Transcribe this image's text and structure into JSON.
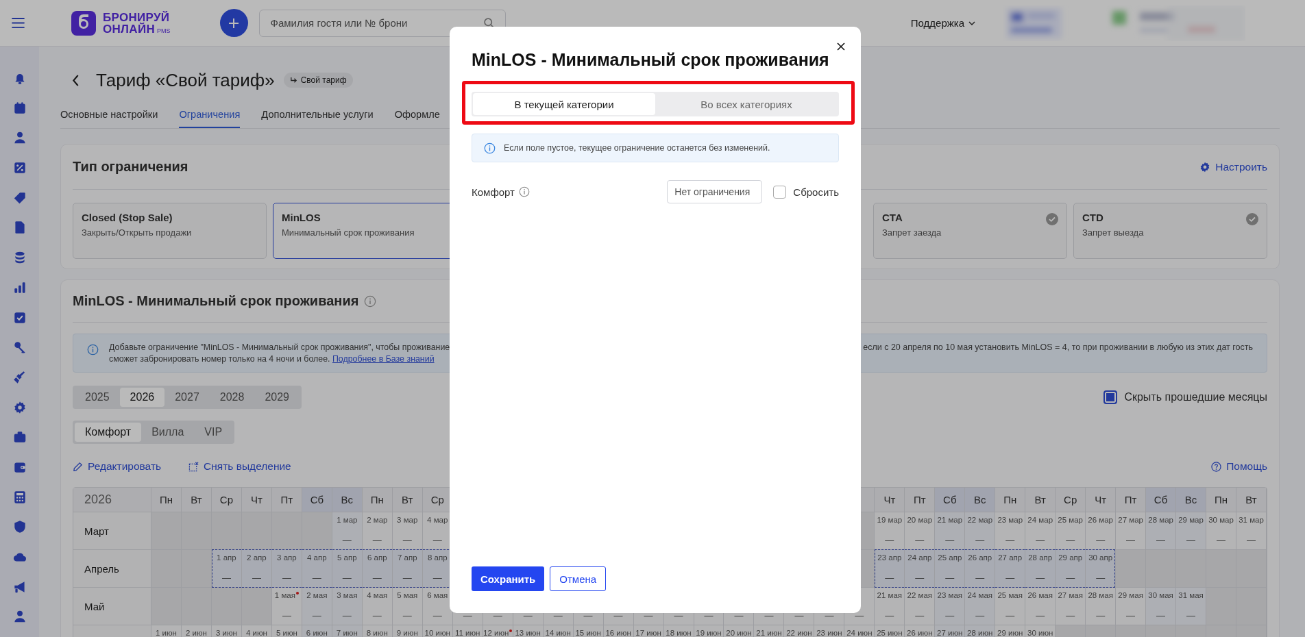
{
  "header": {
    "logo": {
      "line1": "БРОНИРУЙ",
      "line2": "ОНЛАЙН",
      "suffix": "PMS"
    },
    "search": {
      "placeholder": "Фамилия гостя или № брони"
    },
    "support": "Поддержка"
  },
  "page": {
    "title": "Тариф «Свой тариф»",
    "badge": "Свой тариф",
    "tabs": [
      {
        "label": "Основные настройки",
        "selected": false
      },
      {
        "label": "Ограничения",
        "selected": true
      },
      {
        "label": "Дополнительные услуги",
        "selected": false
      },
      {
        "label": "Оформле",
        "selected": false
      }
    ]
  },
  "restriction_type": {
    "title": "Тип ограничения",
    "configure": "Настроить",
    "options": [
      {
        "title": "Closed (Stop Sale)",
        "subtitle": "Закрыть/Открыть продажи",
        "selected": false,
        "checked": false
      },
      {
        "title": "MinLOS",
        "subtitle": "Минимальный срок проживания",
        "selected": true,
        "checked": false
      },
      {
        "title": "CTA",
        "subtitle": "Запрет заезда",
        "selected": false,
        "checked": true
      },
      {
        "title": "CTD",
        "subtitle": "Запрет выезда",
        "selected": false,
        "checked": true
      }
    ]
  },
  "minlos": {
    "title": "MinLOS - Минимальный срок проживания",
    "info": {
      "line1": "Добавьте ограничение \"MinLOS - Минимальный срок проживания\", чтобы проживание",
      "line2": "сможет забронировать номер только на 4 ночи и более.",
      "link": "Подробнее в Базе знаний",
      "right": "если с 20 апреля по 10 мая установить MinLOS = 4, то при проживании в любую из этих дат гость"
    },
    "years": [
      {
        "label": "2025",
        "selected": false
      },
      {
        "label": "2026",
        "selected": true
      },
      {
        "label": "2027",
        "selected": false
      },
      {
        "label": "2028",
        "selected": false
      },
      {
        "label": "2029",
        "selected": false
      }
    ],
    "hide_past": {
      "label": "Скрыть прошедшие месяцы",
      "checked": true
    },
    "categories": [
      {
        "label": "Комфорт",
        "selected": true
      },
      {
        "label": "Вилла",
        "selected": false
      },
      {
        "label": "VIP",
        "selected": false
      }
    ],
    "actions": {
      "edit": "Редактировать",
      "deselect": "Снять выделение",
      "help": "Помощь"
    },
    "calendar": {
      "year": "2026",
      "columns": [
        {
          "label": "Пн",
          "weekend": false
        },
        {
          "label": "Вт",
          "weekend": false
        },
        {
          "label": "Ср",
          "weekend": false
        },
        {
          "label": "Чт",
          "weekend": false
        },
        {
          "label": "Пт",
          "weekend": false
        },
        {
          "label": "Сб",
          "weekend": true
        },
        {
          "label": "Вс",
          "weekend": true
        },
        {
          "label": "Пн",
          "weekend": false
        },
        {
          "label": "Вт",
          "weekend": false
        },
        {
          "label": "Ср",
          "weekend": false
        },
        null,
        null,
        null,
        null,
        null,
        null,
        null,
        null,
        null,
        null,
        null,
        null,
        null,
        null,
        {
          "label": "Чт",
          "weekend": false
        },
        {
          "label": "Пт",
          "weekend": false
        },
        {
          "label": "Сб",
          "weekend": true
        },
        {
          "label": "Вс",
          "weekend": true
        },
        {
          "label": "Пн",
          "weekend": false
        },
        {
          "label": "Вт",
          "weekend": false
        },
        {
          "label": "Ср",
          "weekend": false
        },
        {
          "label": "Чт",
          "weekend": false
        },
        {
          "label": "Пт",
          "weekend": false
        },
        {
          "label": "Сб",
          "weekend": true
        },
        {
          "label": "Вс",
          "weekend": true
        },
        {
          "label": "Пн",
          "weekend": false
        },
        {
          "label": "Вт",
          "weekend": false
        }
      ],
      "rows": [
        {
          "name": "Март",
          "selected": false,
          "cells": [
            null,
            null,
            null,
            null,
            null,
            null,
            {
              "date": "1 мар",
              "value": "—",
              "holiday": false
            },
            {
              "date": "2 мар",
              "value": "—",
              "holiday": false
            },
            {
              "date": "3 мар",
              "value": "—",
              "holiday": false
            },
            {
              "date": "4 мар",
              "value": "—",
              "holiday": false
            },
            null,
            null,
            null,
            null,
            null,
            null,
            null,
            null,
            null,
            null,
            null,
            null,
            null,
            null,
            {
              "date": "19 мар",
              "value": "—",
              "holiday": false
            },
            {
              "date": "20 мар",
              "value": "—",
              "holiday": false
            },
            {
              "date": "21 мар",
              "value": "—",
              "holiday": false
            },
            {
              "date": "22 мар",
              "value": "—",
              "holiday": false
            },
            {
              "date": "23 мар",
              "value": "—",
              "holiday": false
            },
            {
              "date": "24 мар",
              "value": "—",
              "holiday": false
            },
            {
              "date": "25 мар",
              "value": "—",
              "holiday": false
            },
            {
              "date": "26 мар",
              "value": "—",
              "holiday": false
            },
            {
              "date": "27 мар",
              "value": "—",
              "holiday": false
            },
            {
              "date": "28 мар",
              "value": "—",
              "holiday": false
            },
            {
              "date": "29 мар",
              "value": "—",
              "holiday": false
            },
            {
              "date": "30 мар",
              "value": "—",
              "holiday": false
            },
            {
              "date": "31 мар",
              "value": "—",
              "holiday": false
            }
          ]
        },
        {
          "name": "Апрель",
          "selected": true,
          "cells": [
            null,
            null,
            {
              "date": "1 апр",
              "value": "—",
              "holiday": false
            },
            {
              "date": "2 апр",
              "value": "—",
              "holiday": false
            },
            {
              "date": "3 апр",
              "value": "—",
              "holiday": false
            },
            {
              "date": "4 апр",
              "value": "—",
              "holiday": false
            },
            {
              "date": "5 апр",
              "value": "—",
              "holiday": false
            },
            {
              "date": "6 апр",
              "value": "—",
              "holiday": false
            },
            {
              "date": "7 апр",
              "value": "—",
              "holiday": false
            },
            {
              "date": "8 апр",
              "value": "—",
              "holiday": false
            },
            null,
            null,
            null,
            null,
            null,
            null,
            null,
            null,
            null,
            null,
            null,
            null,
            null,
            null,
            {
              "date": "23 апр",
              "value": "—",
              "holiday": false
            },
            {
              "date": "24 апр",
              "value": "—",
              "holiday": false
            },
            {
              "date": "25 апр",
              "value": "—",
              "holiday": false
            },
            {
              "date": "26 апр",
              "value": "—",
              "holiday": false
            },
            {
              "date": "27 апр",
              "value": "—",
              "holiday": false
            },
            {
              "date": "28 апр",
              "value": "—",
              "holiday": false
            },
            {
              "date": "29 апр",
              "value": "—",
              "holiday": false
            },
            {
              "date": "30 апр",
              "value": "—",
              "holiday": false
            },
            null,
            null,
            null,
            null,
            null
          ]
        },
        {
          "name": "Май",
          "selected": false,
          "cells": [
            null,
            null,
            null,
            null,
            {
              "date": "1 мая",
              "value": "—",
              "holiday": true
            },
            {
              "date": "2 мая",
              "value": "—",
              "holiday": false
            },
            {
              "date": "3 мая",
              "value": "—",
              "holiday": false
            },
            {
              "date": "4 мая",
              "value": "—",
              "holiday": false
            },
            {
              "date": "5 мая",
              "value": "—",
              "holiday": false
            },
            {
              "date": "6 мая",
              "value": "—",
              "holiday": false
            },
            {
              "value": "—"
            },
            {
              "value": "—"
            },
            {
              "value": "—"
            },
            {
              "value": "—"
            },
            {
              "value": "—"
            },
            {
              "value": "—"
            },
            {
              "value": "—"
            },
            {
              "value": "—"
            },
            {
              "value": "—"
            },
            {
              "value": "—"
            },
            {
              "value": "—"
            },
            {
              "value": "—"
            },
            {
              "value": "—"
            },
            {
              "value": "—"
            },
            {
              "date": "21 мая",
              "value": "—",
              "holiday": false
            },
            {
              "date": "22 мая",
              "value": "—",
              "holiday": false
            },
            {
              "date": "23 мая",
              "value": "—",
              "holiday": false
            },
            {
              "date": "24 мая",
              "value": "—",
              "holiday": false
            },
            {
              "date": "25 мая",
              "value": "—",
              "holiday": false
            },
            {
              "date": "26 мая",
              "value": "—",
              "holiday": false
            },
            {
              "date": "27 мая",
              "value": "—",
              "holiday": false
            },
            {
              "date": "28 мая",
              "value": "—",
              "holiday": false
            },
            {
              "date": "29 мая",
              "value": "—",
              "holiday": false
            },
            {
              "date": "30 мая",
              "value": "—",
              "holiday": false
            },
            {
              "date": "31 мая",
              "value": "—",
              "holiday": false
            },
            null,
            null
          ]
        },
        {
          "selected": false,
          "cells": [
            {
              "date": "1 июн",
              "holiday": false
            },
            {
              "date": "2 июн",
              "holiday": false
            },
            {
              "date": "3 июн",
              "holiday": false
            },
            {
              "date": "4 июн",
              "holiday": false
            },
            {
              "date": "5 июн",
              "holiday": false
            },
            {
              "date": "6 июн",
              "holiday": false
            },
            {
              "date": "7 июн",
              "holiday": false
            },
            {
              "date": "8 июн",
              "holiday": false
            },
            {
              "date": "9 июн",
              "holiday": false
            },
            {
              "date": "10 июн",
              "holiday": false
            },
            {
              "date": "11 июн",
              "holiday": false
            },
            {
              "date": "12 июн",
              "holiday": true
            },
            {
              "date": "13 июн",
              "holiday": false
            },
            {
              "date": "14 июн",
              "holiday": false
            },
            {
              "date": "15 июн",
              "holiday": false
            },
            {
              "date": "16 июн",
              "holiday": false
            },
            {
              "date": "17 июн",
              "holiday": false
            },
            {
              "date": "18 июн",
              "holiday": false
            },
            {
              "date": "19 июн",
              "holiday": false
            },
            {
              "date": "20 июн",
              "holiday": false
            },
            {
              "date": "21 июн",
              "holiday": false
            },
            {
              "date": "22 июн",
              "holiday": false
            },
            {
              "date": "23 июн",
              "holiday": false
            },
            {
              "date": "24 июн",
              "holiday": false
            },
            {
              "date": "25 июн",
              "holiday": false
            },
            {
              "date": "26 июн",
              "holiday": false
            },
            {
              "date": "27 июн",
              "holiday": false
            },
            {
              "date": "28 июн",
              "holiday": false
            },
            {
              "date": "29 июн",
              "holiday": false
            },
            {
              "date": "30 июн",
              "holiday": false
            },
            null,
            null,
            null,
            null,
            null,
            null,
            null
          ]
        }
      ]
    }
  },
  "modal": {
    "title": "MinLOS - Минимальный срок проживания",
    "highlighted": true,
    "scope_tabs": [
      {
        "label": "В текущей категории",
        "selected": true
      },
      {
        "label": "Во всех категориях",
        "selected": false
      }
    ],
    "info": "Если поле пустое, текущее ограничение останется без изменений.",
    "fields": [
      {
        "label": "Комфорт",
        "placeholder": "Нет ограничения",
        "reset_label": "Сбросить",
        "reset_checked": false
      }
    ],
    "save": "Сохранить",
    "cancel": "Отмена"
  }
}
